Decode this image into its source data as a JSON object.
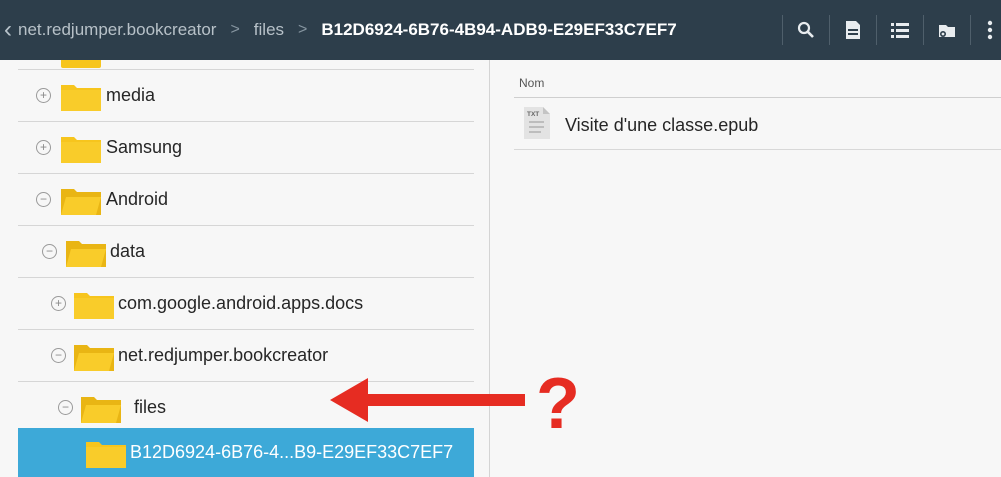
{
  "breadcrumb": {
    "back_icon": "chevron-left-icon",
    "items": [
      "net.redjumper.bookcreator",
      "files",
      "B12D6924-6B76-4B94-ADB9-E29EF33C7EF7"
    ],
    "separator": ">"
  },
  "actions": [
    "search-icon",
    "sd-card-icon",
    "list-view-icon",
    "tools-icon",
    "overflow-menu-icon"
  ],
  "tree": [
    {
      "label": "media",
      "state": "+"
    },
    {
      "label": "Samsung",
      "state": "+"
    },
    {
      "label": "Android",
      "state": "−"
    },
    {
      "label": "data",
      "state": "−"
    },
    {
      "label": "com.google.android.apps.docs",
      "state": "+"
    },
    {
      "label": "net.redjumper.bookcreator",
      "state": "−"
    },
    {
      "label": "files",
      "state": "−"
    },
    {
      "label": "B12D6924-6B76-4...B9-E29EF33C7EF7",
      "state": "",
      "selected": true
    }
  ],
  "list": {
    "column_header": "Nom",
    "files": [
      {
        "name": "Visite d'une classe.epub",
        "icon_text": "TXT"
      }
    ]
  },
  "annotation": {
    "mark": "?",
    "color": "#e62c22"
  },
  "colors": {
    "toolbar_bg": "#2d3e4b",
    "folder": "#f7c51d",
    "selection": "#3da9d8"
  }
}
